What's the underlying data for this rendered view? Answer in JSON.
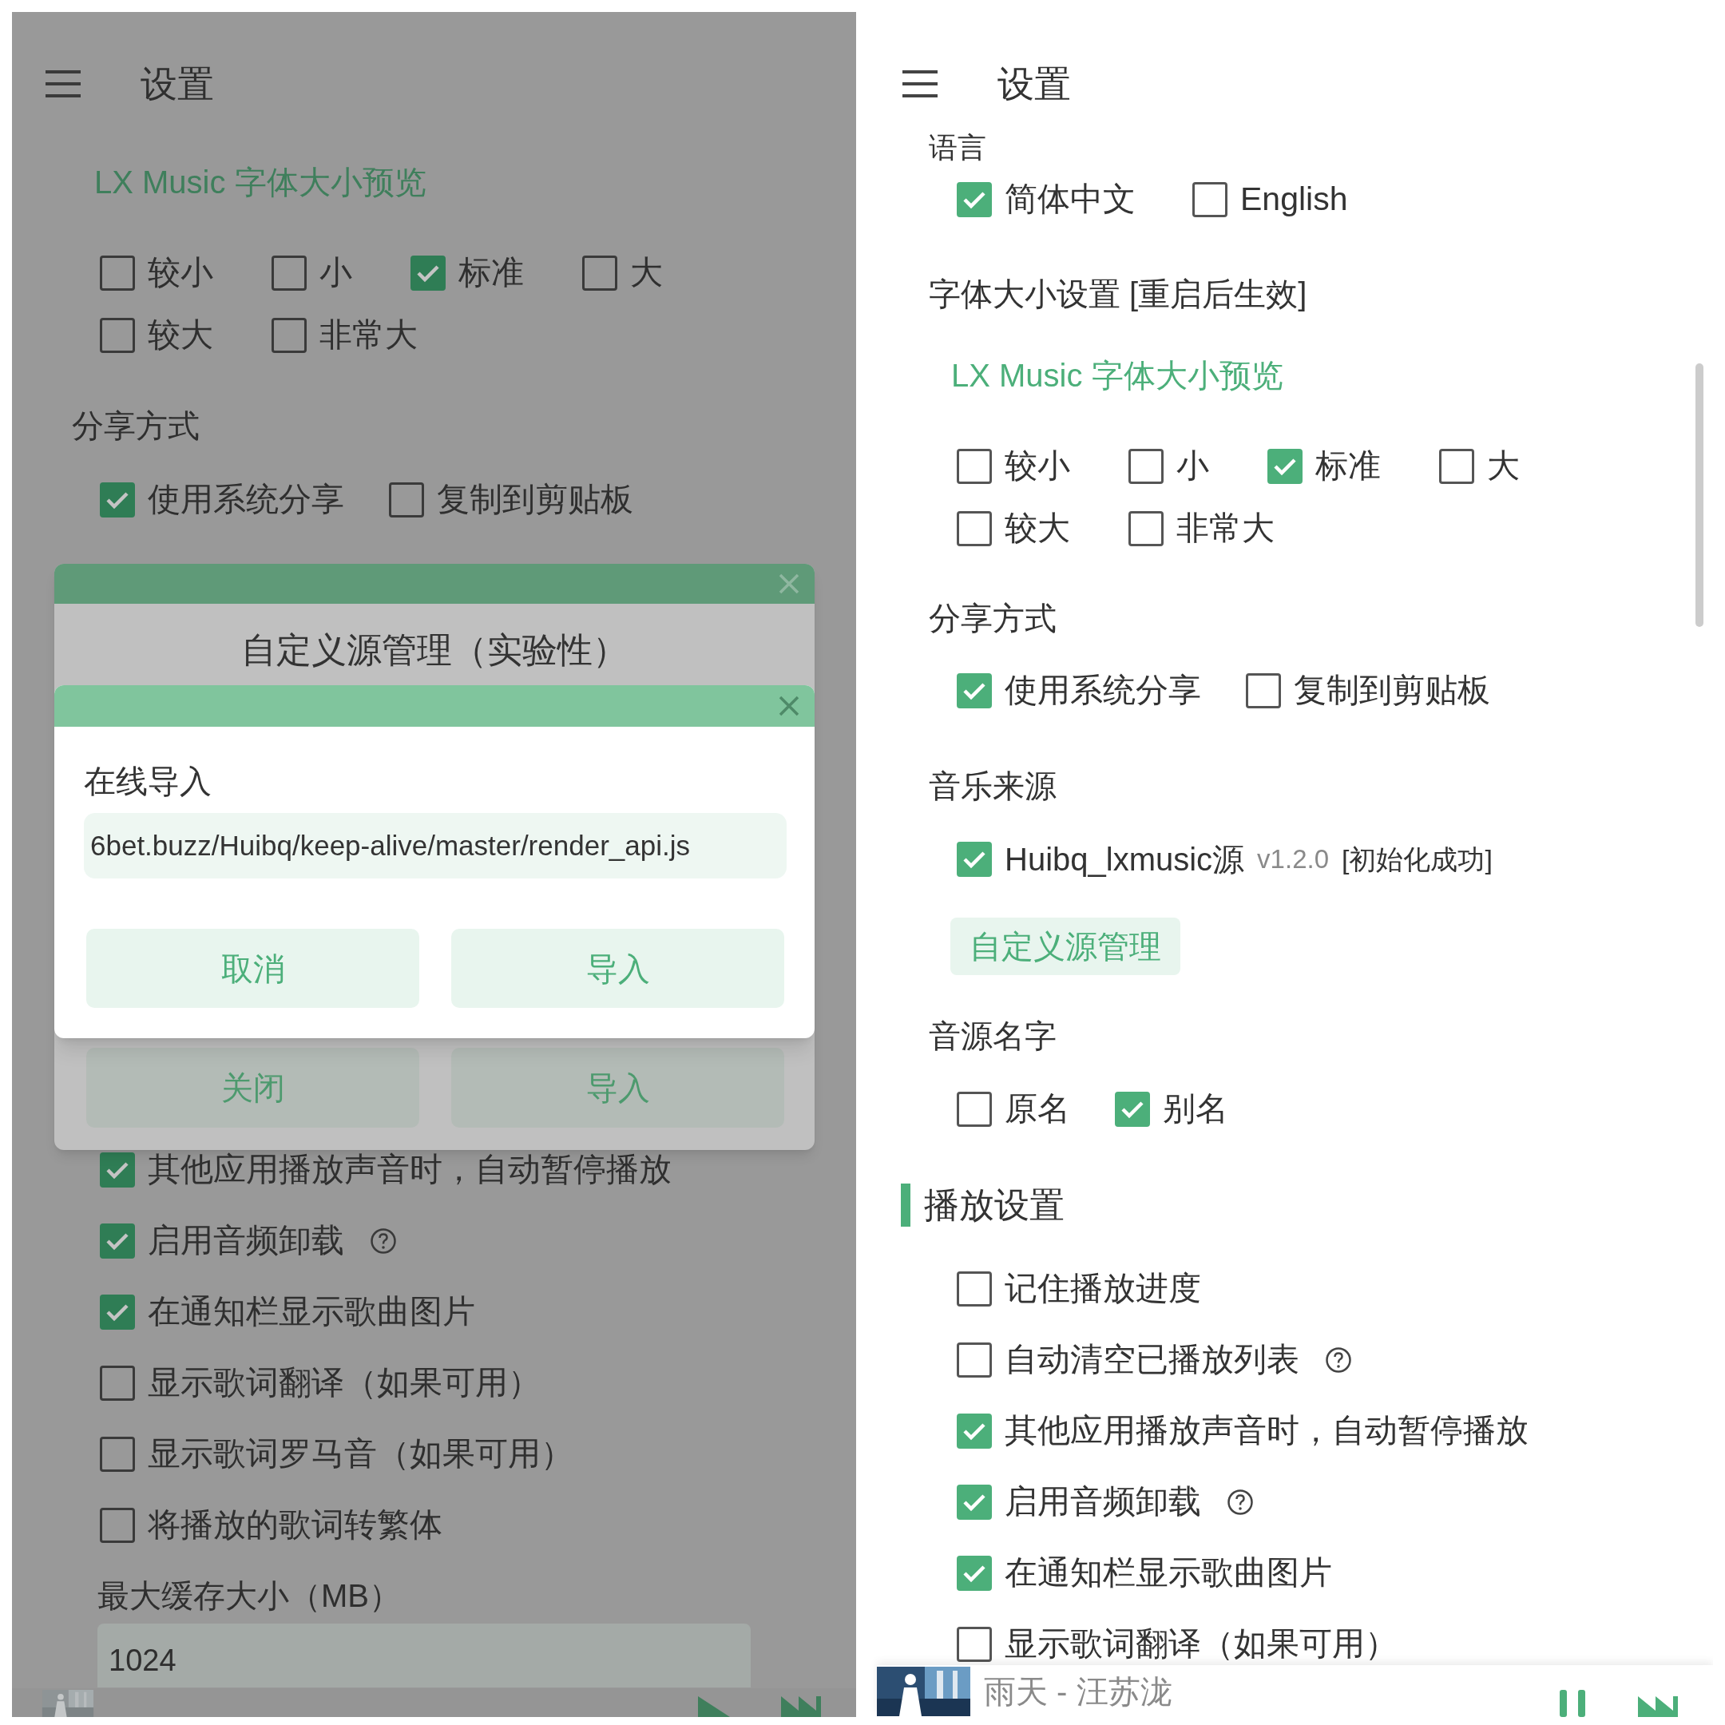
{
  "left_screen": {
    "title": "设置",
    "font_preview": "LX Music 字体大小预览",
    "font_size_rows": [
      [
        {
          "label": "较小",
          "checked": false
        },
        {
          "label": "小",
          "checked": false
        },
        {
          "label": "标准",
          "checked": true
        },
        {
          "label": "大",
          "checked": false
        }
      ],
      [
        {
          "label": "较大",
          "checked": false
        },
        {
          "label": "非常大",
          "checked": false
        }
      ]
    ],
    "share_title": "分享方式",
    "share_options": [
      {
        "label": "使用系统分享",
        "checked": true
      },
      {
        "label": "复制到剪贴板",
        "checked": false
      }
    ],
    "play_options": [
      {
        "label": "其他应用播放声音时，自动暂停播放",
        "checked": true,
        "help": false
      },
      {
        "label": "启用音频卸载",
        "checked": true,
        "help": true
      },
      {
        "label": "在通知栏显示歌曲图片",
        "checked": true,
        "help": false
      },
      {
        "label": "显示歌词翻译（如果可用）",
        "checked": false,
        "help": false
      },
      {
        "label": "显示歌词罗马音（如果可用）",
        "checked": false,
        "help": false
      },
      {
        "label": "将播放的歌词转繁体",
        "checked": false,
        "help": false
      }
    ],
    "cache_label": "最大缓存大小（MB）",
    "cache_value": "1024",
    "source_dialog": {
      "title": "自定义源管理（实验性）",
      "buttons": [
        "关闭",
        "导入"
      ]
    },
    "import_dialog": {
      "title": "在线导入",
      "url": "6bet.buzz/Huibq/keep-alive/master/render_api.js",
      "buttons": [
        "取消",
        "导入"
      ]
    }
  },
  "right_screen": {
    "title": "设置",
    "language_title": "语言",
    "languages": [
      {
        "label": "简体中文",
        "checked": true
      },
      {
        "label": "English",
        "checked": false
      }
    ],
    "font_size_title": "字体大小设置 [重启后生效]",
    "font_preview": "LX Music 字体大小预览",
    "font_size_rows": [
      [
        {
          "label": "较小",
          "checked": false
        },
        {
          "label": "小",
          "checked": false
        },
        {
          "label": "标准",
          "checked": true
        },
        {
          "label": "大",
          "checked": false
        }
      ],
      [
        {
          "label": "较大",
          "checked": false
        },
        {
          "label": "非常大",
          "checked": false
        }
      ]
    ],
    "share_title": "分享方式",
    "share_options": [
      {
        "label": "使用系统分享",
        "checked": true
      },
      {
        "label": "复制到剪贴板",
        "checked": false
      }
    ],
    "music_source_title": "音乐来源",
    "sources": [
      {
        "name": "Huibq_lxmusic源",
        "version": "v1.2.0",
        "status": "[初始化成功]",
        "checked": true
      }
    ],
    "custom_source_button": "自定义源管理",
    "source_name_title": "音源名字",
    "source_name_options": [
      {
        "label": "原名",
        "checked": false
      },
      {
        "label": "别名",
        "checked": true
      }
    ],
    "play_title": "播放设置",
    "play_options": [
      {
        "label": "记住播放进度",
        "checked": false,
        "help": false
      },
      {
        "label": "自动清空已播放列表",
        "checked": false,
        "help": true
      },
      {
        "label": "其他应用播放声音时，自动暂停播放",
        "checked": true,
        "help": false
      },
      {
        "label": "启用音频卸载",
        "checked": true,
        "help": true
      },
      {
        "label": "在通知栏显示歌曲图片",
        "checked": true,
        "help": false
      },
      {
        "label": "显示歌词翻译（如果可用）",
        "checked": false,
        "help": false
      }
    ],
    "now_playing": {
      "title": "雨天 - 汪苏泷"
    }
  }
}
